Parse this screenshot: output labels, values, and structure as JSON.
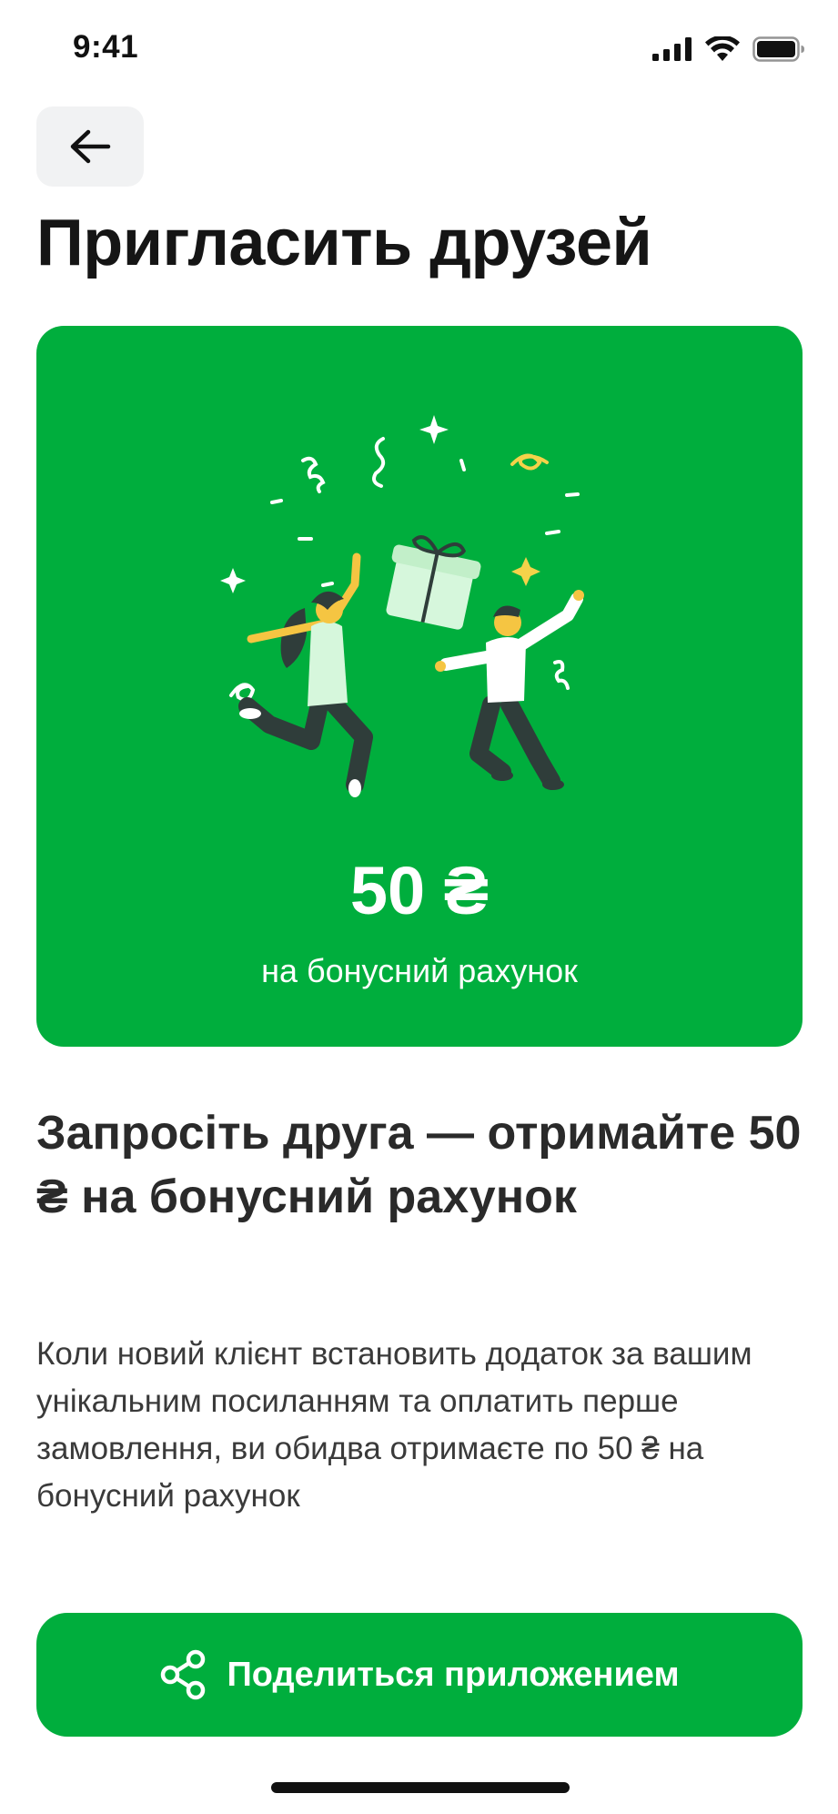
{
  "status_bar": {
    "time": "9:41",
    "icons": [
      "cellular-signal-icon",
      "wifi-icon",
      "battery-icon"
    ]
  },
  "header": {
    "back_icon": "arrow-left-icon",
    "title": "Пригласить друзей"
  },
  "promo_card": {
    "illustration": "celebrating-friends-gift-illustration",
    "amount": "50 ₴",
    "caption": "на бонусний рахунок",
    "background_color": "#00ae3d"
  },
  "section": {
    "heading": "Запросіть друга — отримайте 50 ₴ на бонусний рахунок",
    "description": "Коли новий клієнт встановить додаток за вашим унікальним посиланням та оплатить перше замовлення, ви обидва отримаєте по 50 ₴ на бонусний рахунок"
  },
  "share_button": {
    "icon": "share-icon",
    "label": "Поделиться приложением",
    "color": "#00ae3d"
  }
}
